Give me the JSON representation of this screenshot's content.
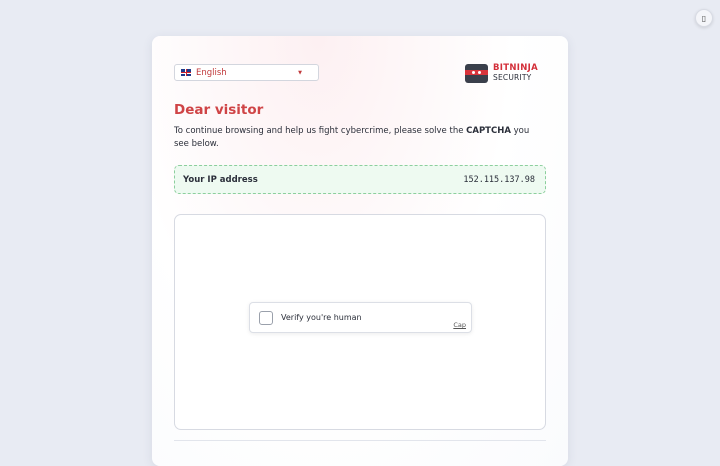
{
  "corner_button": {
    "icon": "info-icon",
    "glyph": "▯"
  },
  "language_select": {
    "selected": "English",
    "flag_icon": "uk-flag-icon"
  },
  "logo": {
    "line1": "BITNINJA",
    "line2": "SECURITY"
  },
  "heading": "Dear visitor",
  "intro": {
    "before": "To continue browsing and help us fight cybercrime, please solve the ",
    "emphasis": "CAPTCHA",
    "after": " you see below."
  },
  "ip": {
    "label": "Your IP address",
    "value": "152.115.137.98"
  },
  "captcha": {
    "label": "Verify you're human",
    "brand": "Cap"
  },
  "colors": {
    "accent": "#cf4446",
    "ip_bg": "#eefaf1",
    "ip_border": "#8ccf9d",
    "page_bg": "#e8ebf3"
  }
}
